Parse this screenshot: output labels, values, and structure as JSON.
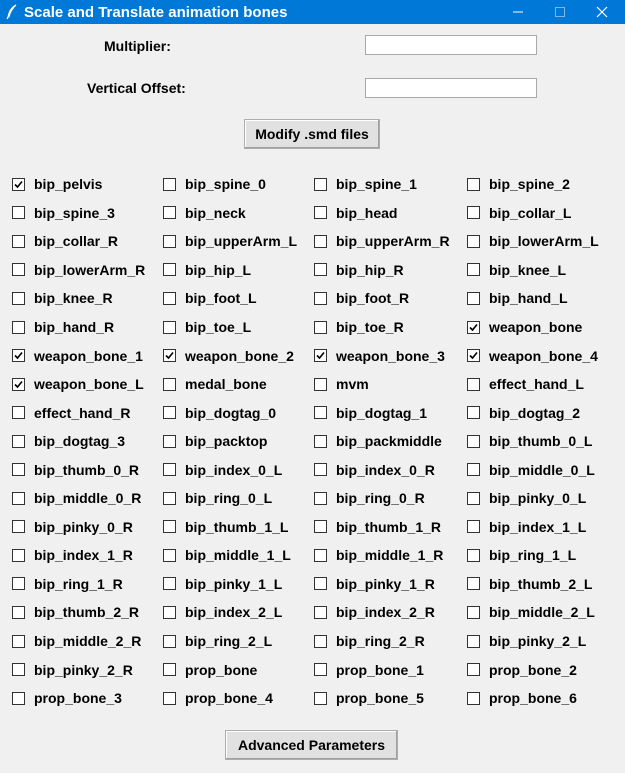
{
  "window": {
    "title": "Scale and Translate animation bones"
  },
  "form": {
    "multiplier_label": "Multiplier:",
    "multiplier_value": "",
    "vertical_offset_label": "Vertical Offset:",
    "vertical_offset_value": "",
    "modify_button": "Modify .smd files"
  },
  "bones": [
    {
      "label": "bip_pelvis",
      "checked": true
    },
    {
      "label": "bip_spine_0",
      "checked": false
    },
    {
      "label": "bip_spine_1",
      "checked": false
    },
    {
      "label": "bip_spine_2",
      "checked": false
    },
    {
      "label": "bip_spine_3",
      "checked": false
    },
    {
      "label": "bip_neck",
      "checked": false
    },
    {
      "label": "bip_head",
      "checked": false
    },
    {
      "label": "bip_collar_L",
      "checked": false
    },
    {
      "label": "bip_collar_R",
      "checked": false
    },
    {
      "label": "bip_upperArm_L",
      "checked": false
    },
    {
      "label": "bip_upperArm_R",
      "checked": false
    },
    {
      "label": "bip_lowerArm_L",
      "checked": false
    },
    {
      "label": "bip_lowerArm_R",
      "checked": false
    },
    {
      "label": "bip_hip_L",
      "checked": false
    },
    {
      "label": "bip_hip_R",
      "checked": false
    },
    {
      "label": "bip_knee_L",
      "checked": false
    },
    {
      "label": "bip_knee_R",
      "checked": false
    },
    {
      "label": "bip_foot_L",
      "checked": false
    },
    {
      "label": "bip_foot_R",
      "checked": false
    },
    {
      "label": "bip_hand_L",
      "checked": false
    },
    {
      "label": "bip_hand_R",
      "checked": false
    },
    {
      "label": "bip_toe_L",
      "checked": false
    },
    {
      "label": "bip_toe_R",
      "checked": false
    },
    {
      "label": "weapon_bone",
      "checked": true
    },
    {
      "label": "weapon_bone_1",
      "checked": true
    },
    {
      "label": "weapon_bone_2",
      "checked": true
    },
    {
      "label": "weapon_bone_3",
      "checked": true
    },
    {
      "label": "weapon_bone_4",
      "checked": true
    },
    {
      "label": "weapon_bone_L",
      "checked": true
    },
    {
      "label": "medal_bone",
      "checked": false
    },
    {
      "label": "mvm",
      "checked": false
    },
    {
      "label": "effect_hand_L",
      "checked": false
    },
    {
      "label": "effect_hand_R",
      "checked": false
    },
    {
      "label": "bip_dogtag_0",
      "checked": false
    },
    {
      "label": "bip_dogtag_1",
      "checked": false
    },
    {
      "label": "bip_dogtag_2",
      "checked": false
    },
    {
      "label": "bip_dogtag_3",
      "checked": false
    },
    {
      "label": "bip_packtop",
      "checked": false
    },
    {
      "label": "bip_packmiddle",
      "checked": false
    },
    {
      "label": "bip_thumb_0_L",
      "checked": false
    },
    {
      "label": "bip_thumb_0_R",
      "checked": false
    },
    {
      "label": "bip_index_0_L",
      "checked": false
    },
    {
      "label": "bip_index_0_R",
      "checked": false
    },
    {
      "label": "bip_middle_0_L",
      "checked": false
    },
    {
      "label": "bip_middle_0_R",
      "checked": false
    },
    {
      "label": "bip_ring_0_L",
      "checked": false
    },
    {
      "label": "bip_ring_0_R",
      "checked": false
    },
    {
      "label": "bip_pinky_0_L",
      "checked": false
    },
    {
      "label": "bip_pinky_0_R",
      "checked": false
    },
    {
      "label": "bip_thumb_1_L",
      "checked": false
    },
    {
      "label": "bip_thumb_1_R",
      "checked": false
    },
    {
      "label": "bip_index_1_L",
      "checked": false
    },
    {
      "label": "bip_index_1_R",
      "checked": false
    },
    {
      "label": "bip_middle_1_L",
      "checked": false
    },
    {
      "label": "bip_middle_1_R",
      "checked": false
    },
    {
      "label": "bip_ring_1_L",
      "checked": false
    },
    {
      "label": "bip_ring_1_R",
      "checked": false
    },
    {
      "label": "bip_pinky_1_L",
      "checked": false
    },
    {
      "label": "bip_pinky_1_R",
      "checked": false
    },
    {
      "label": "bip_thumb_2_L",
      "checked": false
    },
    {
      "label": "bip_thumb_2_R",
      "checked": false
    },
    {
      "label": "bip_index_2_L",
      "checked": false
    },
    {
      "label": "bip_index_2_R",
      "checked": false
    },
    {
      "label": "bip_middle_2_L",
      "checked": false
    },
    {
      "label": "bip_middle_2_R",
      "checked": false
    },
    {
      "label": "bip_ring_2_L",
      "checked": false
    },
    {
      "label": "bip_ring_2_R",
      "checked": false
    },
    {
      "label": "bip_pinky_2_L",
      "checked": false
    },
    {
      "label": "bip_pinky_2_R",
      "checked": false
    },
    {
      "label": "prop_bone",
      "checked": false
    },
    {
      "label": "prop_bone_1",
      "checked": false
    },
    {
      "label": "prop_bone_2",
      "checked": false
    },
    {
      "label": "prop_bone_3",
      "checked": false
    },
    {
      "label": "prop_bone_4",
      "checked": false
    },
    {
      "label": "prop_bone_5",
      "checked": false
    },
    {
      "label": "prop_bone_6",
      "checked": false
    }
  ],
  "footer": {
    "advanced_button": "Advanced Parameters"
  },
  "colors": {
    "titlebar": "#0078d7",
    "window_bg": "#f0f0f0",
    "button_bg": "#e1e1e1"
  },
  "icons": {
    "app": "feather-icon",
    "minimize": "minimize-icon",
    "maximize": "maximize-icon",
    "close": "close-icon",
    "check": "checkmark-icon"
  }
}
